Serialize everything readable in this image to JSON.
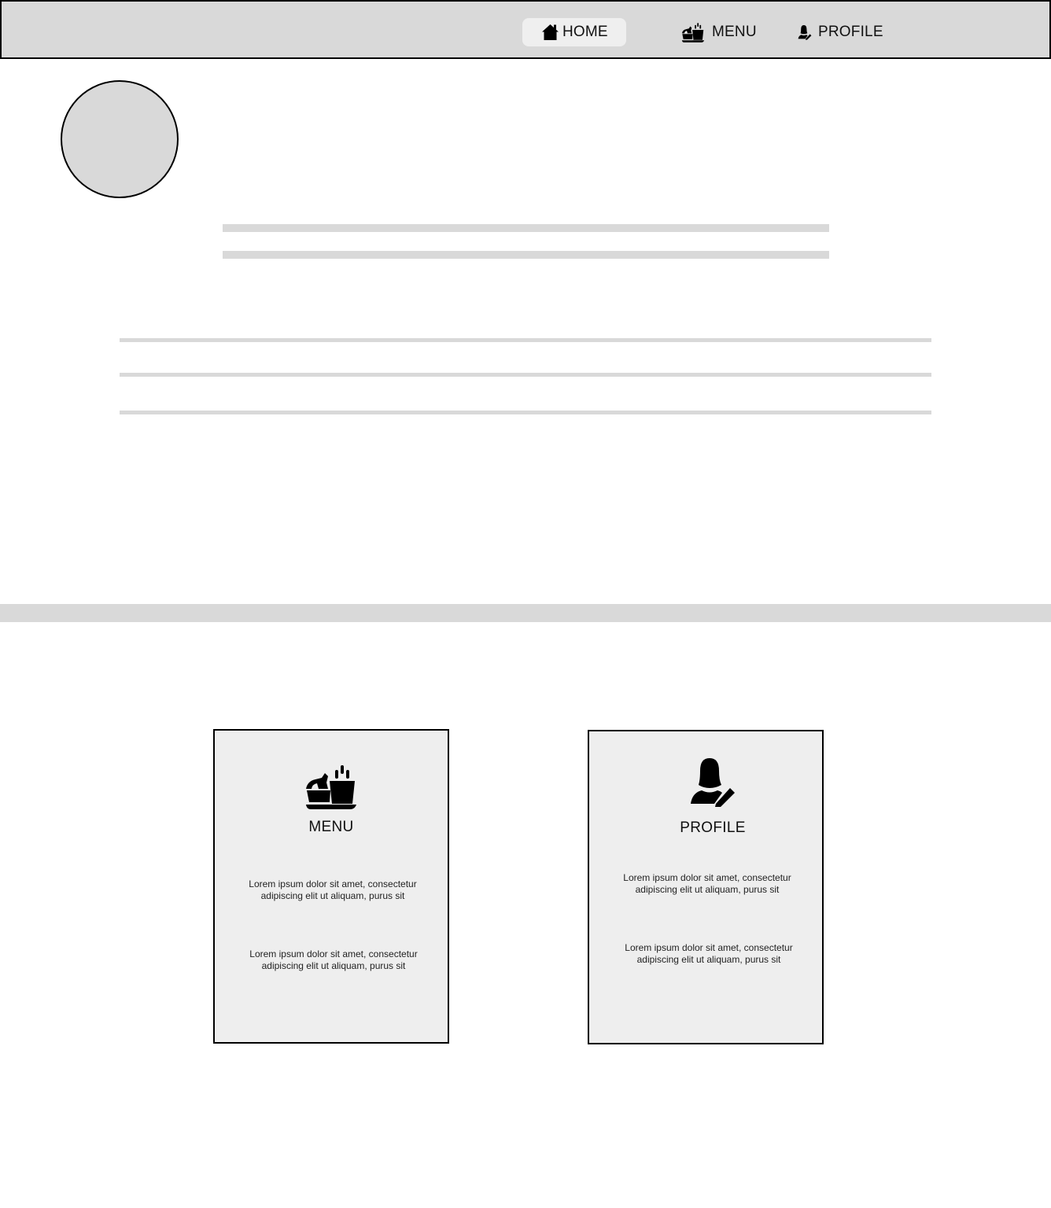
{
  "nav": {
    "items": [
      {
        "label": "HOME",
        "icon": "home-icon",
        "active": true
      },
      {
        "label": "MENU",
        "icon": "food-icon",
        "active": false
      },
      {
        "label": "PROFILE",
        "icon": "user-edit-icon",
        "active": false
      }
    ]
  },
  "cards": [
    {
      "title": "MENU",
      "icon": "food-icon",
      "paragraphs": [
        "Lorem ipsum dolor sit amet, consectetur adipiscing elit ut aliquam, purus sit",
        "Lorem ipsum dolor sit amet, consectetur adipiscing elit ut aliquam, purus sit"
      ]
    },
    {
      "title": "PROFILE",
      "icon": "user-edit-icon",
      "paragraphs": [
        "Lorem ipsum dolor sit amet, consectetur adipiscing elit ut aliquam, purus sit",
        "Lorem ipsum dolor sit amet, consectetur adipiscing elit ut aliquam, purus sit"
      ]
    }
  ],
  "colors": {
    "placeholder": "#d9d9d9",
    "card_background": "#eeeeee",
    "active_nav_background": "#efefef",
    "border": "#000000"
  }
}
